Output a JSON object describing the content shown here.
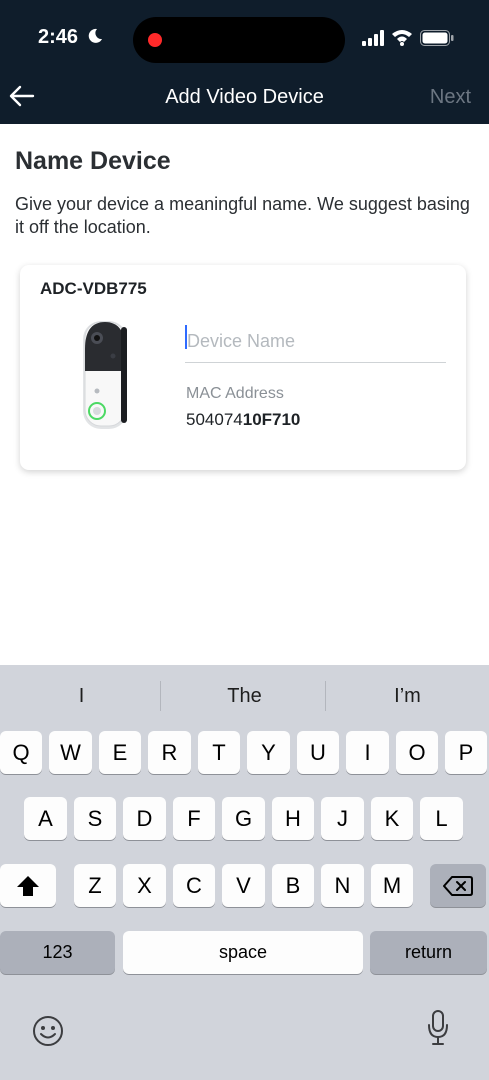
{
  "status_bar": {
    "time": "2:46"
  },
  "nav": {
    "title": "Add Video Device",
    "next_label": "Next"
  },
  "content": {
    "title": "Name Device",
    "subtitle": "Give your device a meaningful name. We suggest basing it off the location."
  },
  "device": {
    "model": "ADC-VDB775",
    "name_placeholder": "Device Name",
    "mac_label": "MAC Address",
    "mac_prefix": "504074",
    "mac_suffix": "10F710"
  },
  "keyboard": {
    "suggestions": [
      "I",
      "The",
      "I’m"
    ],
    "row1": [
      "Q",
      "W",
      "E",
      "R",
      "T",
      "Y",
      "U",
      "I",
      "O",
      "P"
    ],
    "row2": [
      "A",
      "S",
      "D",
      "F",
      "G",
      "H",
      "J",
      "K",
      "L"
    ],
    "row3": [
      "Z",
      "X",
      "C",
      "V",
      "B",
      "N",
      "M"
    ],
    "numbers_label": "123",
    "space_label": "space",
    "return_label": "return"
  },
  "colors": {
    "header": "#0f1d2b",
    "accent": "#2f6bff",
    "keyboard_bg": "#d1d4db"
  },
  "icons": [
    "back-arrow-icon",
    "moon-icon",
    "signal-icon",
    "wifi-icon",
    "battery-icon",
    "shift-icon",
    "delete-icon",
    "emoji-icon",
    "mic-icon"
  ]
}
